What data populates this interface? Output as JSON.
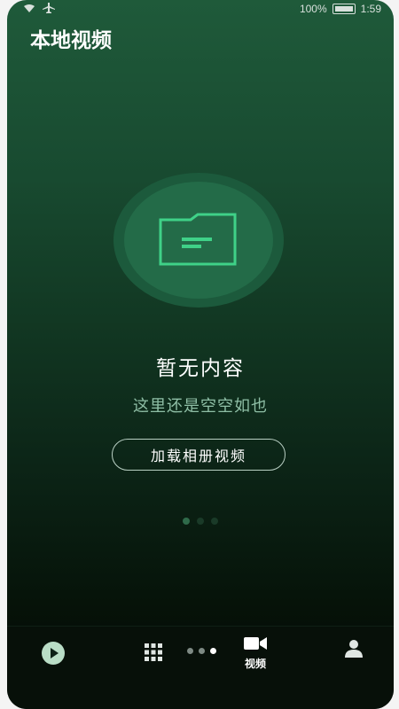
{
  "status_bar": {
    "battery": "100%",
    "time": "1:59"
  },
  "header": {
    "title": "本地视频"
  },
  "empty_state": {
    "title": "暂无内容",
    "subtitle": "这里还是空空如也",
    "button_label": "加载相册视频"
  },
  "pager": {
    "count": 3,
    "active_index": 0
  },
  "bottom_nav": {
    "items": [
      {
        "icon": "play-circle-icon",
        "label": ""
      },
      {
        "icon": "grid-icon",
        "label": ""
      },
      {
        "icon": "video-camera-icon",
        "label": "视频"
      },
      {
        "icon": "user-icon",
        "label": ""
      }
    ],
    "active": "video"
  },
  "colors": {
    "accent_green": "#2f9a68",
    "text_subtle": "#8fbfa6"
  }
}
